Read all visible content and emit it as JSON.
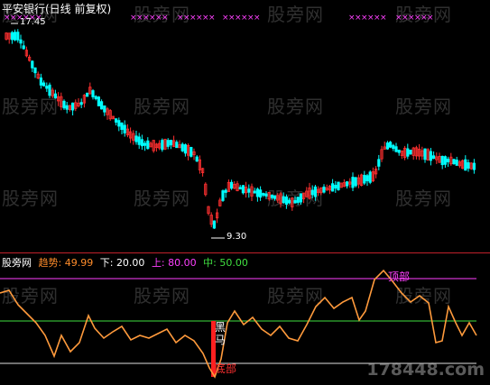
{
  "header": {
    "title": "平安银行(日线 前复权)"
  },
  "price": {
    "high": "17.45",
    "low": "9.30"
  },
  "indicator": {
    "name": "股旁网",
    "trend_label": "趋势:",
    "trend_value": "49.99",
    "lower_label": "下:",
    "lower_value": "20.00",
    "upper_label": "上:",
    "upper_value": "80.00",
    "mid_label": "中:",
    "mid_value": "50.00",
    "top_label": "顶部",
    "bottom_label": "底部",
    "signal_label": "黑马"
  },
  "watermark": {
    "text": "股旁网",
    "site": "178448.com"
  },
  "colors": {
    "up": "#ff3030",
    "down": "#00ffff",
    "trend": "#ff9a3c",
    "upper": "#ff40ff",
    "mid": "#40e040",
    "lower": "#e0e0e0",
    "trend_label": "#ff8c2a",
    "upper_label": "#ff40ff",
    "mid_label": "#40e040"
  },
  "chart_data": [
    {
      "type": "candlestick",
      "title": "平安银行(日线 前复权)",
      "annotations": [
        "17.45",
        "9.30"
      ],
      "ylim": [
        9.3,
        17.45
      ]
    },
    {
      "type": "line",
      "series": [
        {
          "name": "趋势",
          "last": 49.99
        }
      ],
      "hlines": {
        "上": 80.0,
        "中": 50.0,
        "下": 20.0
      },
      "annotations": [
        "顶部",
        "底部",
        "黑马"
      ]
    }
  ]
}
